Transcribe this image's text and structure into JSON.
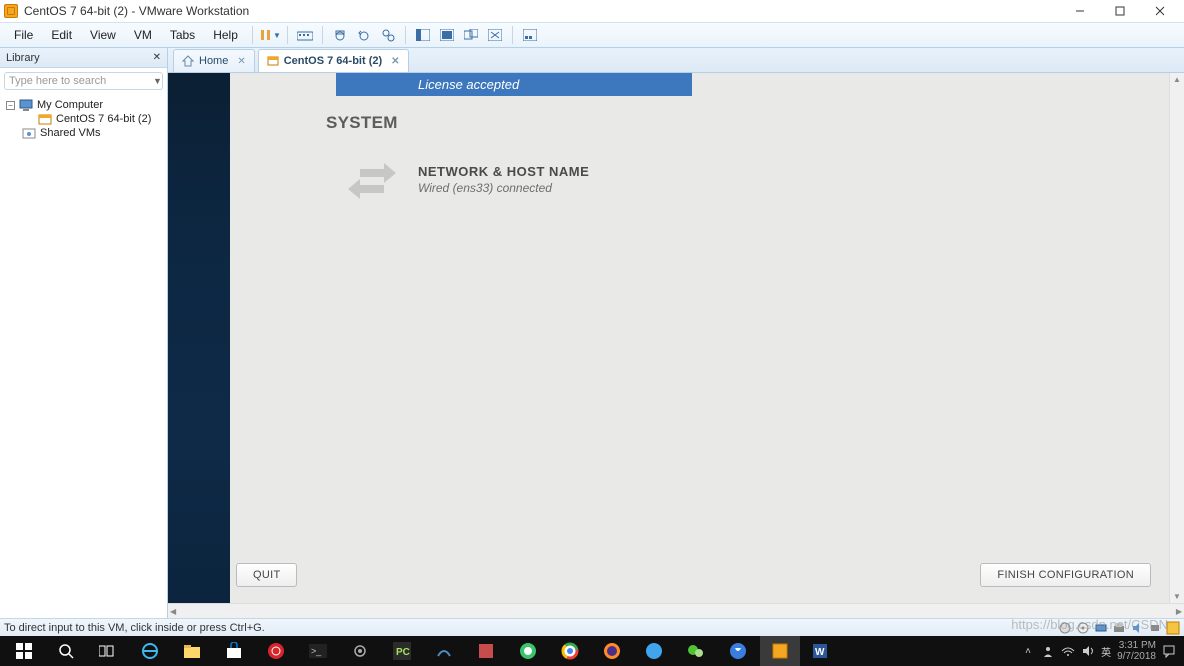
{
  "window": {
    "title": "CentOS 7 64-bit (2) - VMware Workstation"
  },
  "menubar": {
    "items": [
      "File",
      "Edit",
      "View",
      "VM",
      "Tabs",
      "Help"
    ]
  },
  "library": {
    "title": "Library",
    "search_placeholder": "Type here to search",
    "tree": {
      "root": "My Computer",
      "child": "CentOS 7 64-bit (2)",
      "shared": "Shared VMs"
    }
  },
  "tabs": {
    "home": "Home",
    "vm": "CentOS 7 64-bit (2)"
  },
  "installer": {
    "license_status": "License accepted",
    "section": "SYSTEM",
    "spoke_title": "NETWORK & HOST NAME",
    "spoke_sub": "Wired (ens33) connected",
    "quit": "QUIT",
    "finish": "FINISH CONFIGURATION"
  },
  "statusbar": {
    "hint": "To direct input to this VM, click inside or press Ctrl+G."
  },
  "tray": {
    "ime": "英",
    "time": "3:31 PM",
    "date": "9/7/2018"
  },
  "watermark": "https://blog.csdn.net/CSDN"
}
